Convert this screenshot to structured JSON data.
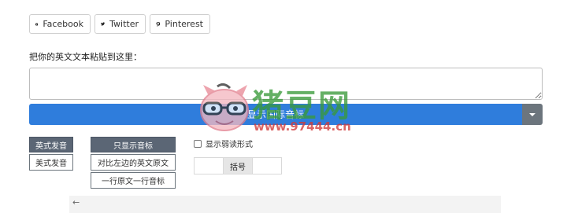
{
  "share": {
    "facebook": "Facebook",
    "twitter": "Twitter",
    "pinterest": "Pinterest"
  },
  "input_label": "把你的英文文本粘贴到这里：",
  "input_value": "",
  "main_button": "显示国际音标",
  "accent_group": {
    "head": "英式发音",
    "item": "美式发音"
  },
  "mode_group": {
    "head": "只显示音标",
    "items": [
      "对比左边的英文原文",
      "一行原文一行音标"
    ]
  },
  "weak_forms": "显示弱读形式",
  "bracket": "括号",
  "watermark": {
    "title": "猪豆网",
    "url": "www.97444.cn"
  },
  "colors": {
    "primary": "#2f7ddc",
    "secondary": "#6c757d",
    "option_head": "#5b6675"
  },
  "icons": [
    "facebook-icon",
    "twitter-icon",
    "pinterest-icon",
    "caret-down-icon",
    "back-arrow-icon",
    "pig-logo-icon"
  ]
}
